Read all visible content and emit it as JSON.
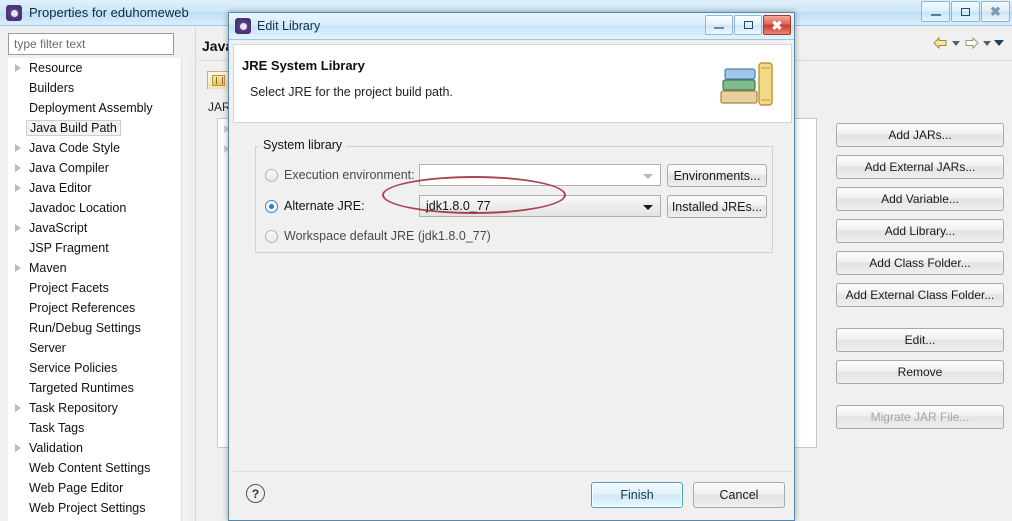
{
  "main_window": {
    "title": "Properties for eduhomeweb",
    "icon": "app-icon",
    "window_controls": {
      "minimize": "–",
      "maximize": "□",
      "close": "✕"
    },
    "nav": {
      "back": "back-arrow-icon",
      "back_menu": "chevron-down-icon",
      "forward": "forward-arrow-icon",
      "forward_menu": "chevron-down-icon",
      "view_menu": "chevron-down-icon"
    },
    "filter": {
      "placeholder": "type filter text",
      "value": ""
    },
    "tree": [
      {
        "label": "Resource",
        "expandable": true,
        "selected": false
      },
      {
        "label": "Builders",
        "expandable": false,
        "selected": false
      },
      {
        "label": "Deployment Assembly",
        "expandable": false,
        "selected": false
      },
      {
        "label": "Java Build Path",
        "expandable": false,
        "selected": true
      },
      {
        "label": "Java Code Style",
        "expandable": true,
        "selected": false
      },
      {
        "label": "Java Compiler",
        "expandable": true,
        "selected": false
      },
      {
        "label": "Java Editor",
        "expandable": true,
        "selected": false
      },
      {
        "label": "Javadoc Location",
        "expandable": false,
        "selected": false
      },
      {
        "label": "JavaScript",
        "expandable": true,
        "selected": false
      },
      {
        "label": "JSP Fragment",
        "expandable": false,
        "selected": false
      },
      {
        "label": "Maven",
        "expandable": true,
        "selected": false
      },
      {
        "label": "Project Facets",
        "expandable": false,
        "selected": false
      },
      {
        "label": "Project References",
        "expandable": false,
        "selected": false
      },
      {
        "label": "Run/Debug Settings",
        "expandable": false,
        "selected": false
      },
      {
        "label": "Server",
        "expandable": false,
        "selected": false
      },
      {
        "label": "Service Policies",
        "expandable": false,
        "selected": false
      },
      {
        "label": "Targeted Runtimes",
        "expandable": false,
        "selected": false
      },
      {
        "label": "Task Repository",
        "expandable": true,
        "selected": false
      },
      {
        "label": "Task Tags",
        "expandable": false,
        "selected": false
      },
      {
        "label": "Validation",
        "expandable": true,
        "selected": false
      },
      {
        "label": "Web Content Settings",
        "expandable": false,
        "selected": false
      },
      {
        "label": "Web Page Editor",
        "expandable": false,
        "selected": false
      },
      {
        "label": "Web Project Settings",
        "expandable": false,
        "selected": false
      }
    ],
    "content": {
      "page_title": "Java",
      "tab_icon": "package-folder-icon",
      "tab_label": "JAR"
    },
    "side_buttons": [
      {
        "label": "Add JARs...",
        "enabled": true,
        "gap_above": false
      },
      {
        "label": "Add External JARs...",
        "enabled": true,
        "gap_above": false
      },
      {
        "label": "Add Variable...",
        "enabled": true,
        "gap_above": false
      },
      {
        "label": "Add Library...",
        "enabled": true,
        "gap_above": false
      },
      {
        "label": "Add Class Folder...",
        "enabled": true,
        "gap_above": false
      },
      {
        "label": "Add External Class Folder...",
        "enabled": true,
        "gap_above": false
      },
      {
        "label": "Edit...",
        "enabled": true,
        "gap_above": true
      },
      {
        "label": "Remove",
        "enabled": true,
        "gap_above": false
      },
      {
        "label": "Migrate JAR File...",
        "enabled": false,
        "gap_above": true
      }
    ]
  },
  "dialog": {
    "title": "Edit Library",
    "icon": "app-icon",
    "window_controls": {
      "minimize": "–",
      "maximize": "□",
      "close": "✕"
    },
    "header": {
      "title": "JRE System Library",
      "subtitle": "Select JRE for the project build path.",
      "icon": "books-stack-icon"
    },
    "group": {
      "legend": "System library",
      "options": [
        {
          "id": "execution-environment",
          "label": "Execution environment:",
          "selected": false,
          "combo_value": "",
          "combo_enabled": false,
          "button": "Environments..."
        },
        {
          "id": "alternate-jre",
          "label": "Alternate JRE:",
          "selected": true,
          "combo_value": "jdk1.8.0_77",
          "combo_enabled": true,
          "button": "Installed JREs..."
        },
        {
          "id": "workspace-default-jre",
          "label": "Workspace default JRE (jdk1.8.0_77)",
          "selected": false
        }
      ]
    },
    "annotation": {
      "type": "red-ellipse-highlight",
      "color": "#9e2335",
      "target": "alternate-jre-combo"
    },
    "footer": {
      "help": "?",
      "finish": "Finish",
      "cancel": "Cancel"
    }
  }
}
